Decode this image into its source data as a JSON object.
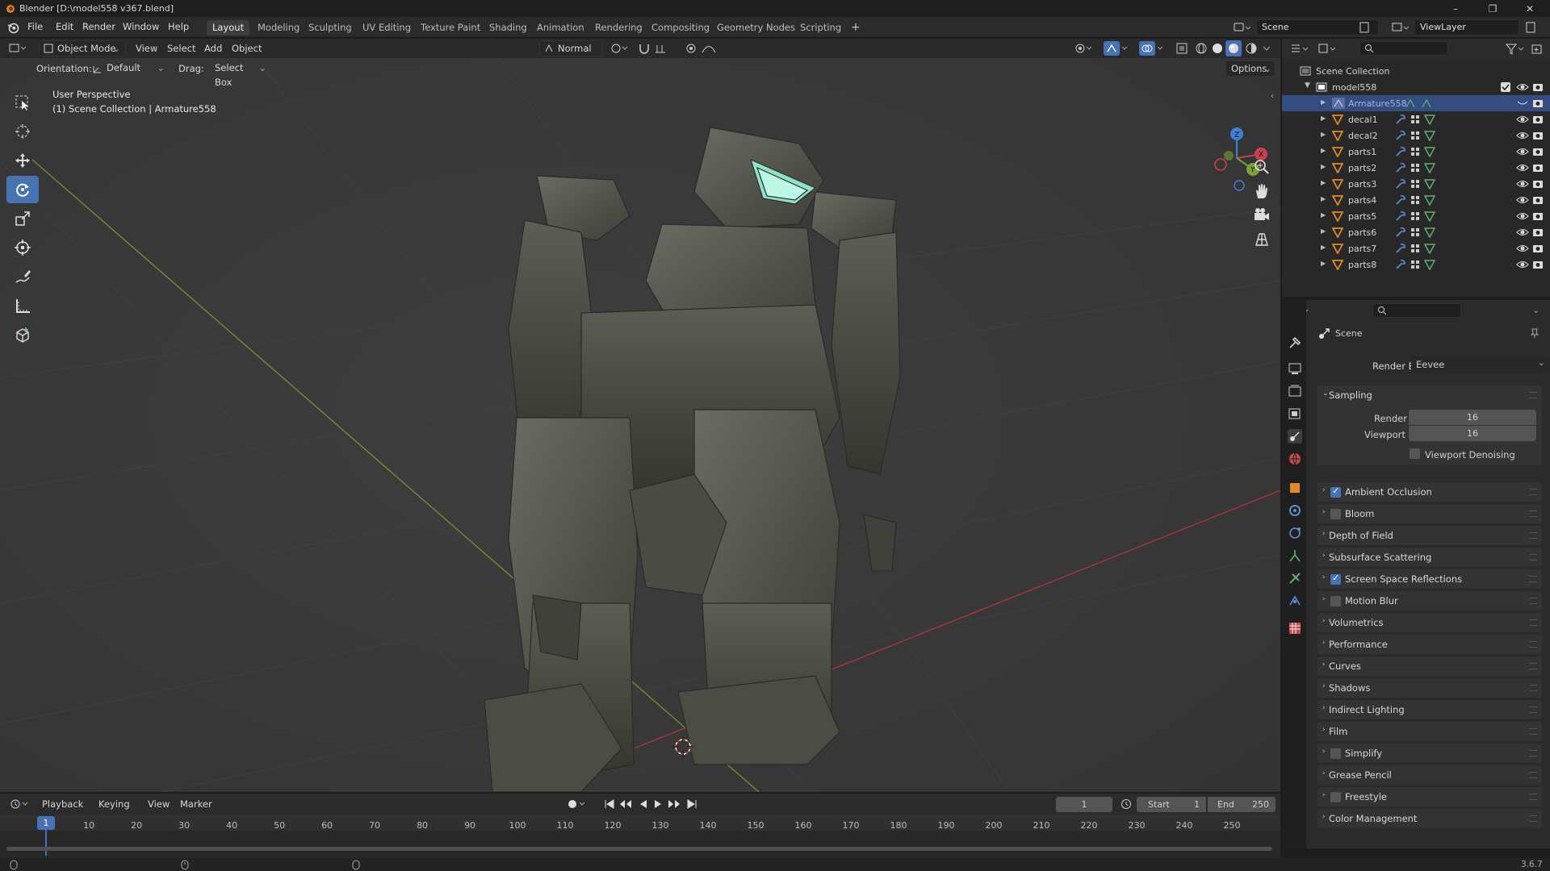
{
  "window": {
    "title": "Blender [D:\\model558 v367.blend]",
    "controls": [
      "–",
      "❐",
      "✕"
    ]
  },
  "menu": [
    "File",
    "Edit",
    "Render",
    "Window",
    "Help"
  ],
  "workspaces": [
    "Layout",
    "Modeling",
    "Sculpting",
    "UV Editing",
    "Texture Paint",
    "Shading",
    "Animation",
    "Rendering",
    "Compositing",
    "Geometry Nodes",
    "Scripting"
  ],
  "workspace_add": "+",
  "scene_field": "Scene",
  "viewlayer_field": "ViewLayer",
  "viewport_header": {
    "mode": "Object Mode",
    "menus": [
      "View",
      "Select",
      "Add",
      "Object"
    ],
    "orientation_label": "Orientation:",
    "orientation_value": "Default",
    "drag_label": "Drag:",
    "drag_value": "Select Box",
    "transform": "Normal",
    "options": "Options"
  },
  "viewport": {
    "perspective": "User Perspective",
    "context": "(1) Scene Collection | Armature558"
  },
  "outliner": {
    "root": "Scene Collection",
    "collection": "model558",
    "items": [
      "Armature558",
      "decal1",
      "decal2",
      "parts1",
      "parts2",
      "parts3",
      "parts4",
      "parts5",
      "parts6",
      "parts7",
      "parts8"
    ],
    "selected_index": 0
  },
  "properties": {
    "context": "Scene",
    "render_engine_label": "Render Engine",
    "render_engine_value": "Eevee",
    "sampling": {
      "title": "Sampling",
      "render_label": "Render",
      "render_value": "16",
      "viewport_label": "Viewport",
      "viewport_value": "16",
      "denoise_label": "Viewport Denoising",
      "denoise_checked": false
    },
    "panels": [
      {
        "label": "Ambient Occlusion",
        "checkbox": true,
        "checked": true
      },
      {
        "label": "Bloom",
        "checkbox": true,
        "checked": false
      },
      {
        "label": "Depth of Field",
        "checkbox": false
      },
      {
        "label": "Subsurface Scattering",
        "checkbox": false
      },
      {
        "label": "Screen Space Reflections",
        "checkbox": true,
        "checked": true
      },
      {
        "label": "Motion Blur",
        "checkbox": true,
        "checked": false
      },
      {
        "label": "Volumetrics",
        "checkbox": false
      },
      {
        "label": "Performance",
        "checkbox": false
      },
      {
        "label": "Curves",
        "checkbox": false
      },
      {
        "label": "Shadows",
        "checkbox": false
      },
      {
        "label": "Indirect Lighting",
        "checkbox": false
      },
      {
        "label": "Film",
        "checkbox": false
      },
      {
        "label": "Simplify",
        "checkbox": true,
        "checked": false
      },
      {
        "label": "Grease Pencil",
        "checkbox": false
      },
      {
        "label": "Freestyle",
        "checkbox": true,
        "checked": false
      },
      {
        "label": "Color Management",
        "checkbox": false
      }
    ]
  },
  "timeline": {
    "menus": [
      "Playback",
      "Keying",
      "View",
      "Marker"
    ],
    "current_frame": "1",
    "start_label": "Start",
    "start_value": "1",
    "end_label": "End",
    "end_value": "250",
    "ticks": [
      "10",
      "20",
      "30",
      "40",
      "50",
      "60",
      "70",
      "80",
      "90",
      "100",
      "110",
      "120",
      "130",
      "140",
      "150",
      "160",
      "170",
      "180",
      "190",
      "200",
      "210",
      "220",
      "230",
      "240",
      "250"
    ]
  },
  "status": {
    "version": "3.6.7"
  },
  "colors": {
    "accent": "#4772b3",
    "selection": "#334d80",
    "x_axis": "#c9404c",
    "y_axis": "#7aa033",
    "z_axis": "#3f7fd6"
  }
}
